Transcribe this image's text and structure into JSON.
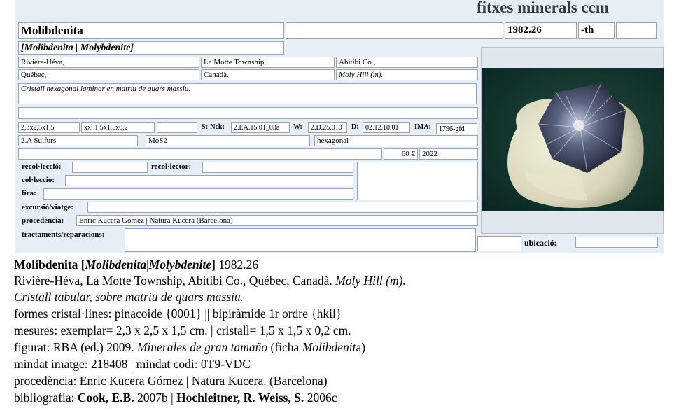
{
  "header": {
    "title": "fitxes minerals ccm"
  },
  "card": {
    "name": "Molibdenita",
    "name_extra": "",
    "code": "1982.26",
    "suffix": "-th",
    "suffix_extra": "",
    "synonyms": "[Molibdenita | Molybdenite]",
    "locality1": "Rivière-Héva,",
    "locality2": "La Motte Township,",
    "locality3": "Abitibi Co.,",
    "locality4": "Québec,",
    "locality5": "Canadà.",
    "locality6": "Moly Hill (m).",
    "description": "Cristall hexagonal laminar en matriu de quars massiu.",
    "dim_specimen": "2,3x2,5x1,5",
    "dim_crystal": "xx: 1,5x1,5x0,2",
    "strunz_label": "St-Nck:",
    "strunz": "2.EA.15.01_03a",
    "w_label": "W:",
    "w_value": "2.D.25.010",
    "d_label": "D:",
    "d_value": "02.12.10.01",
    "ima_label": "IMA:",
    "ima_value": "1796-gfd",
    "class": "2.A Sulfurs",
    "formula": "MoS2",
    "system": "hexagonal",
    "price": "60 €",
    "year": "2022",
    "recoleccio_label": "recol·lecció:",
    "recolector_label": "recol·lector:",
    "colleccio_label": "col·leccio:",
    "fira_label": "fira:",
    "excursio_label": "excursió/viatge:",
    "procedencia_label": "procedència:",
    "procedencia": "Enric Kucera Gómez | Natura Kucera (Barcelona)",
    "tractaments_label": "tractaments/reparacions:",
    "ubicacio_label": "ubicació:"
  },
  "photo": {
    "icon": "mineral-photo",
    "matrix_color": "#d9d6bd",
    "crystal_color": "#2e3448",
    "background": "#12332b"
  },
  "summary": {
    "l1_name": "Molibdenita",
    "l1_open": " [",
    "l1_syn1": "Molibdenita",
    "l1_sep": "|",
    "l1_syn2": "Molybdenite",
    "l1_close": "]",
    "l1_code": " 1982.26",
    "l2_text": "Rivière-Héva, La Motte Township, Abitibi Co., Québec, Canadà. ",
    "l2_italic": "Moly Hill (m).",
    "l3": "Cristall tabular, sobre matriu de quars massiu.",
    "l4": "formes cristal·lines: pinacoide {0001} || bipiràmide 1r ordre {hkil}",
    "l5": "mesures: exemplar= 2,3 x 2,5 x 1,5 cm. | cristall= 1,5 x 1,5 x 0,2 cm.",
    "l6_a": "figurat: RBA (ed.) 2009. ",
    "l6_italic": "Minerales de gran tamaño",
    "l6_b": " (ficha ",
    "l6_italic2": "Molibdenit",
    "l6_c": "a)",
    "l7": "mindat imatge: 218408 | mindat codi: 0T9-VDC",
    "l8": "procedència: Enric Kucera Gómez | Natura Kucera. (Barcelona)",
    "l9_a": "bibliografia: ",
    "l9_b1": "Cook, E.B.",
    "l9_c": " 2007b | ",
    "l9_b2": "Hochleitner, R. Weiss, S.",
    "l9_d": " 2006c"
  }
}
